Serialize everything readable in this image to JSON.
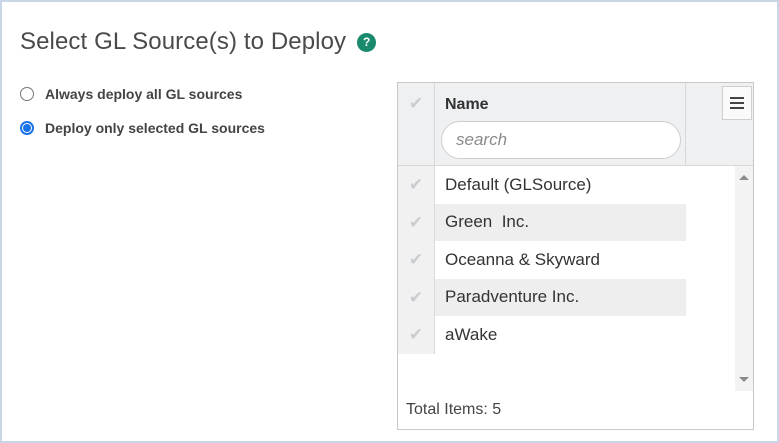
{
  "page": {
    "title": "Select GL Source(s) to Deploy",
    "help_glyph": "?"
  },
  "options": {
    "all_label": "Always deploy all GL sources",
    "selected_label": "Deploy only selected GL sources",
    "selected": "selected"
  },
  "grid": {
    "header_name": "Name",
    "search_placeholder": "search",
    "rows": [
      {
        "name": "Default (GLSource)"
      },
      {
        "name": "Green  Inc."
      },
      {
        "name": "Oceanna & Skyward"
      },
      {
        "name": "Paradventure Inc."
      },
      {
        "name": "aWake"
      }
    ],
    "footer": "Total Items: 5"
  },
  "icons": {
    "help": "help-circle-icon",
    "check": "checkmark-icon",
    "menu": "hamburger-menu-icon",
    "scroll_up": "scroll-up-arrow-icon",
    "scroll_down": "scroll-down-arrow-icon"
  },
  "colors": {
    "help_badge": "#1a8a6e",
    "radio_accent": "#1a73e8",
    "frame_border": "#c9d6e8",
    "header_bg": "#eef0f2",
    "alt_row_bg": "#eeeeee"
  }
}
